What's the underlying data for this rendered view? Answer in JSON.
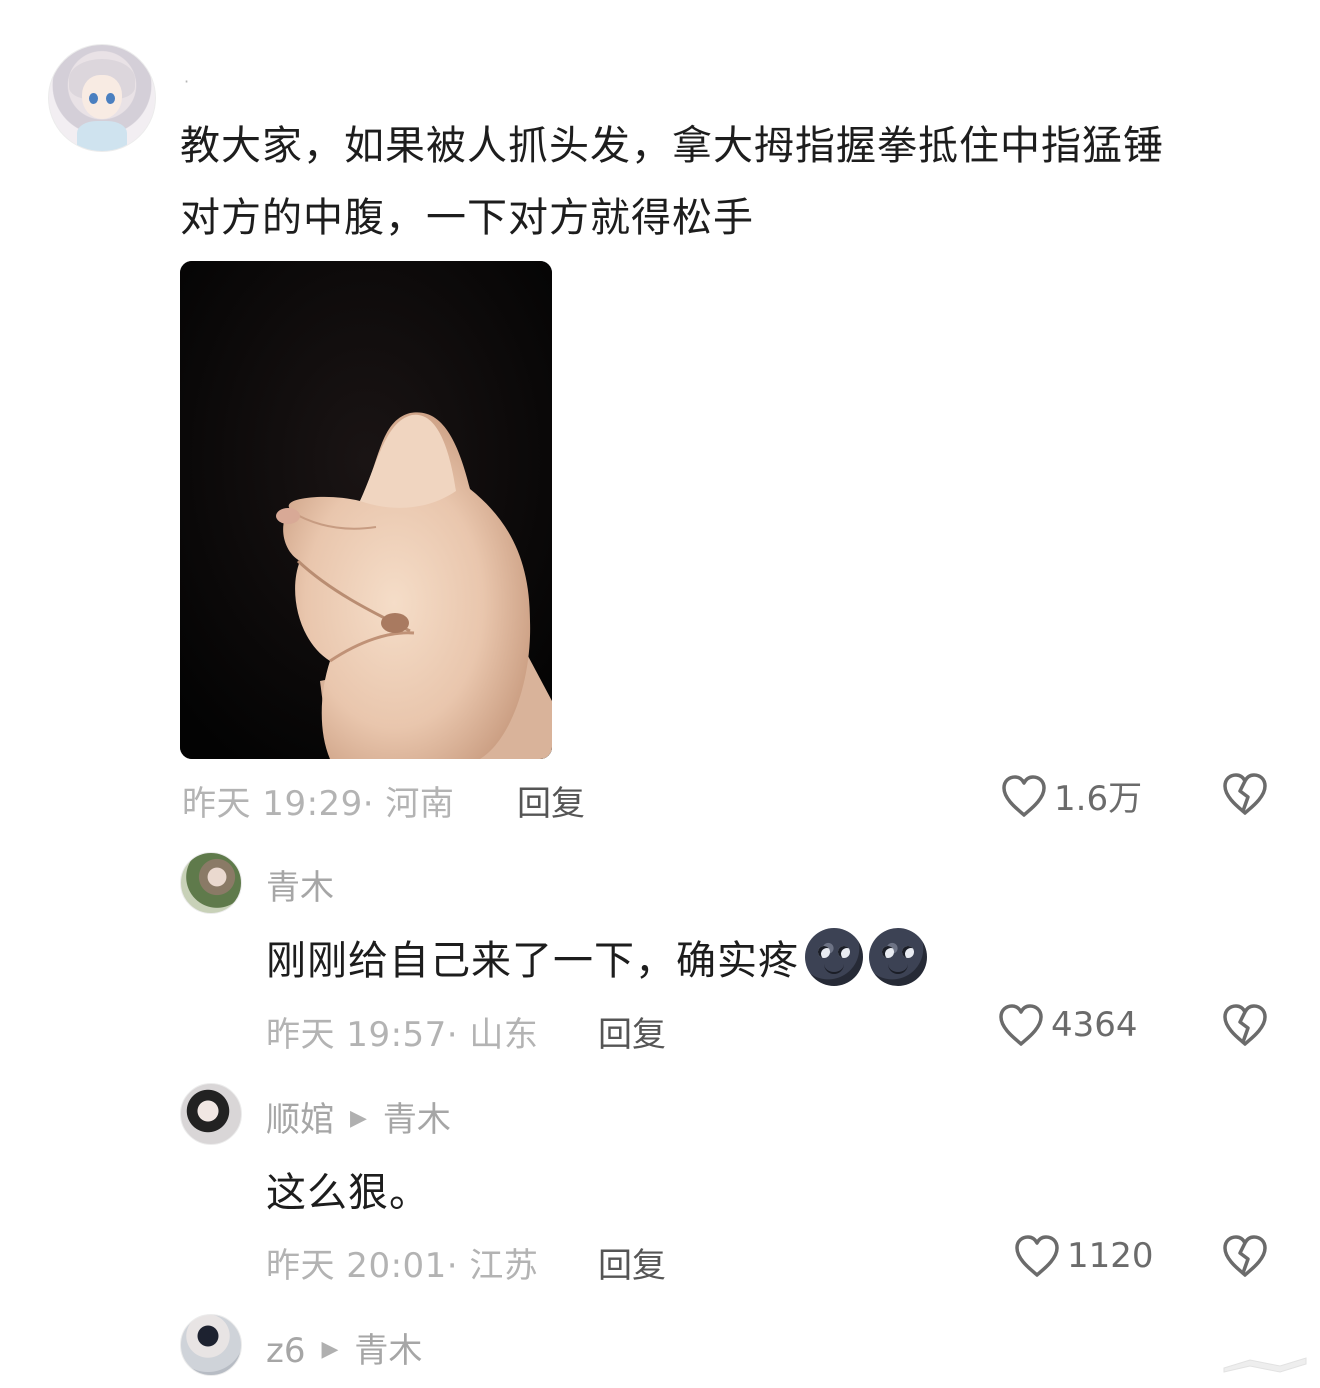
{
  "main_comment": {
    "username": "·",
    "text_line1": "教大家，如果被人抓头发，拿大拇指握拳抵住中指猛锤",
    "text_line2": "对方的中腹，一下对方就得松手",
    "meta": "昨天 19:29· 河南",
    "reply_label": "回复",
    "likes": "1.6万"
  },
  "replies": [
    {
      "username": "青木",
      "reply_to": "",
      "text": "刚刚给自己来了一下，确实疼",
      "emoji": [
        "new-moon-face",
        "new-moon-face"
      ],
      "meta": "昨天 19:57· 山东",
      "reply_label": "回复",
      "likes": "4364"
    },
    {
      "username": "顺婠",
      "reply_to": "青木",
      "text": "这么狠。",
      "meta": "昨天 20:01· 江苏",
      "reply_label": "回复",
      "likes": "1120"
    },
    {
      "username": "z6",
      "reply_to": "青木"
    }
  ],
  "colors": {
    "text": "#1d1d1d",
    "meta": "#b3b3b3",
    "reply": "#555555",
    "icon": "#6b6b6b"
  }
}
